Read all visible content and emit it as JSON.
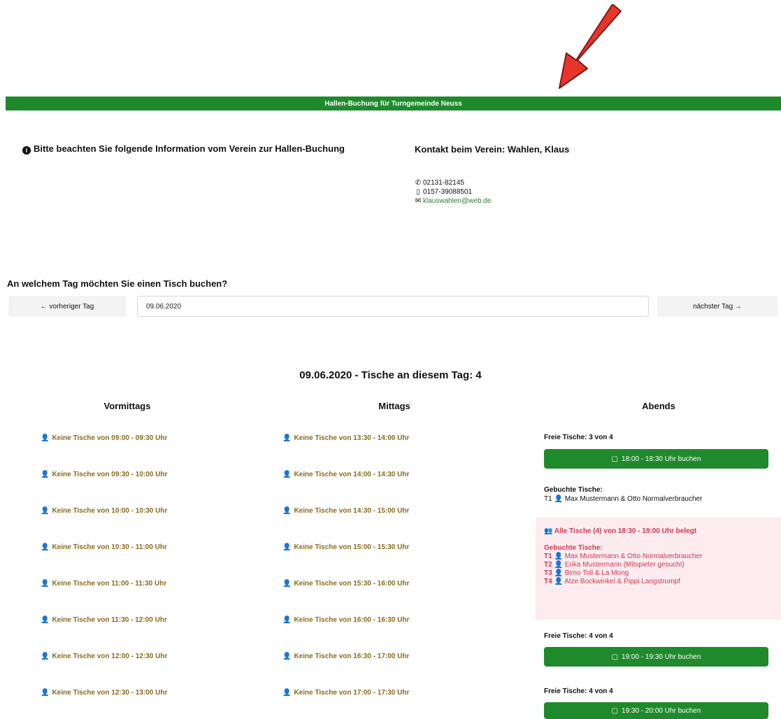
{
  "colors": {
    "accent_green": "#1f8a2c",
    "slot_brown": "#8b6a1e",
    "full_red": "#d8374f",
    "arrow_red": "#e8352b"
  },
  "banner": {
    "title": "Hallen-Buchung für Turngemeinde Neuss"
  },
  "info": {
    "title": "Bitte beachten Sie folgende Information vom Verein zur Hallen-Buchung",
    "icon": "info-circle-icon"
  },
  "contact": {
    "title": "Kontakt beim Verein: Wahlen, Klaus",
    "phone": "02131-82145",
    "mobile": "0157-39088501",
    "email": "klauswahlen@web.de"
  },
  "booking": {
    "question": "An welchem Tag möchten Sie einen Tisch buchen?",
    "prev_label": "← vorheriger Tag",
    "next_label": "nächster Tag →",
    "date_value": "09.06.2020"
  },
  "day": {
    "heading": "09.06.2020 - Tische an diesem Tag: 4"
  },
  "columns": {
    "morning": {
      "title": "Vormittags",
      "slots": [
        "Keine Tische von 09:00 - 09:30 Uhr",
        "Keine Tische von 09:30 - 10:00 Uhr",
        "Keine Tische von 10:00 - 10:30 Uhr",
        "Keine Tische von 10:30 - 11:00 Uhr",
        "Keine Tische von 11:00 - 11:30 Uhr",
        "Keine Tische von 11:30 - 12:00 Uhr",
        "Keine Tische von 12:00 - 12:30 Uhr",
        "Keine Tische von 12:30 - 13:00 Uhr"
      ]
    },
    "midday": {
      "title": "Mittags",
      "slots": [
        "Keine Tische von 13:30 - 14:00 Uhr",
        "Keine Tische von 14:00 - 14:30 Uhr",
        "Keine Tische von 14:30 - 15:00 Uhr",
        "Keine Tische von 15:00 - 15:30 Uhr",
        "Keine Tische von 15:30 - 16:00 Uhr",
        "Keine Tische von 16:00 - 16:30 Uhr",
        "Keine Tische von 16:30 - 17:00 Uhr",
        "Keine Tische von 17:00 - 17:30 Uhr"
      ]
    },
    "evening": {
      "title": "Abends",
      "block1": {
        "free": "Freie Tische: 3 von 4",
        "button": "18:00 - 18:30 Uhr buchen",
        "booked_label": "Gebuchte Tische:",
        "booked": [
          {
            "table": "T1",
            "names": "Max Mustermann & Otto Normalverbraucher"
          }
        ]
      },
      "block2": {
        "full_msg": "Alle Tische (4) von 18:30 - 19:00 Uhr belegt",
        "booked_label": "Gebuchte Tische:",
        "booked": [
          {
            "table": "T1",
            "names": "Max Mustermann & Otto Normalverbraucher"
          },
          {
            "table": "T2",
            "names": "Erika Mustermann (Mitspieler gesucht)"
          },
          {
            "table": "T3",
            "names": "Bimo Toll & La Mong"
          },
          {
            "table": "T4",
            "names": "Atze Bockwinkel & Pippi Langstrumpf"
          }
        ]
      },
      "block3": {
        "free": "Freie Tische: 4 von 4",
        "button": "19:00 - 19:30 Uhr buchen"
      },
      "block4": {
        "free": "Freie Tische: 4 von 4",
        "button": "19:30 - 20:00 Uhr buchen"
      }
    }
  }
}
